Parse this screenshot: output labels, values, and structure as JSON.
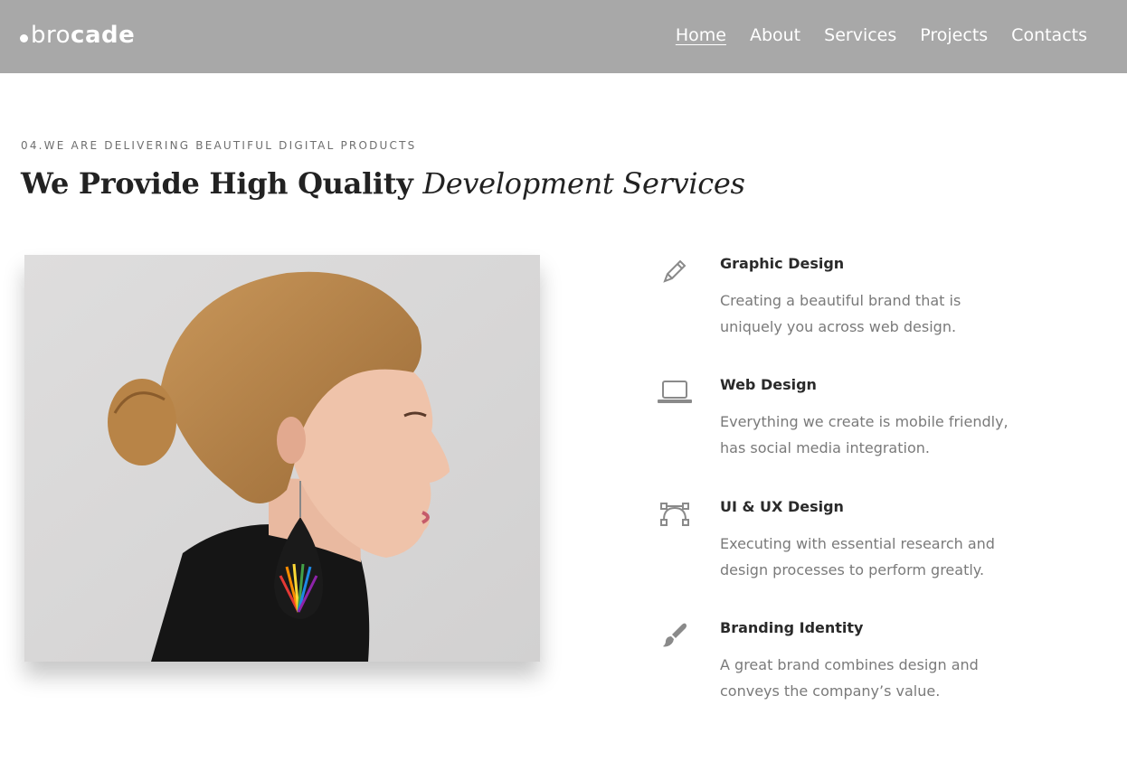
{
  "navbar": {
    "logo": {
      "light": "bro",
      "bold": "cade"
    },
    "links": [
      {
        "label": "Home",
        "active": true
      },
      {
        "label": "About",
        "active": false
      },
      {
        "label": "Services",
        "active": false
      },
      {
        "label": "Projects",
        "active": false
      },
      {
        "label": "Contacts",
        "active": false
      }
    ]
  },
  "section": {
    "eyebrow": "04.WE ARE DELIVERING BEAUTIFUL DIGITAL PRODUCTS",
    "headline_bold": "We Provide High Quality",
    "headline_italic": "Development Services"
  },
  "services": [
    {
      "icon": "pencil-icon",
      "title": "Graphic Design",
      "desc": "Creating a beautiful brand that is uniquely you across web design."
    },
    {
      "icon": "laptop-icon",
      "title": "Web Design",
      "desc": "Everything we create is mobile friendly, has social media integration."
    },
    {
      "icon": "vector-path-icon",
      "title": "UI & UX Design",
      "desc": "Executing with essential research and design processes to perform greatly."
    },
    {
      "icon": "paintbrush-icon",
      "title": "Branding Identity",
      "desc": "A great brand combines design and conveys the company’s value."
    }
  ],
  "colors": {
    "navbar_bg": "#a8a8a8",
    "text_dark": "#2a2a2a",
    "text_muted": "#7a7a7a",
    "icon_gray": "#8a8a8a"
  }
}
